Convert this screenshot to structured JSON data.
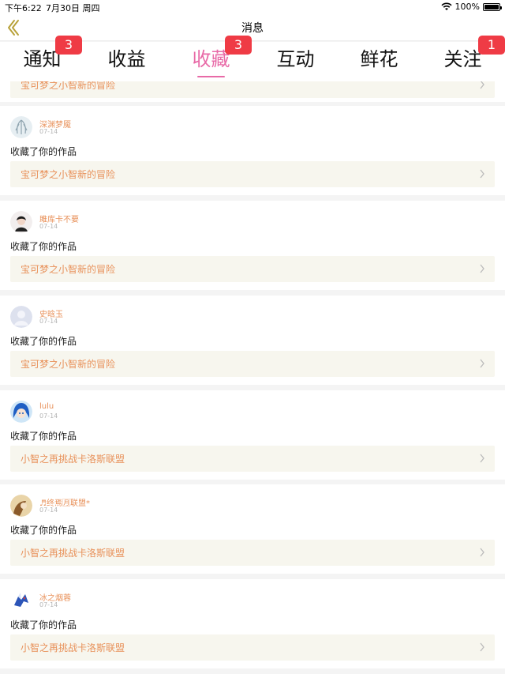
{
  "status_bar": {
    "time": "下午6:22",
    "date": "7月30日 周四",
    "battery": "100%"
  },
  "nav": {
    "title": "消息",
    "back_icon": "chevron-left-icon",
    "accent_color": "#b8a23a"
  },
  "tabs": [
    {
      "label": "通知",
      "badge": "3",
      "active": false
    },
    {
      "label": "收益",
      "badge": "",
      "active": false
    },
    {
      "label": "收藏",
      "badge": "3",
      "active": true
    },
    {
      "label": "互动",
      "badge": "",
      "active": false
    },
    {
      "label": "鲜花",
      "badge": "",
      "active": false
    },
    {
      "label": "关注",
      "badge": "1",
      "active": false
    }
  ],
  "colors": {
    "active_tab": "#e86aa7",
    "badge": "#ef3b45",
    "username": "#e8915a",
    "work_bg": "#f7f6ee"
  },
  "partial_item": {
    "work_title": "宝可梦之小智新的冒险"
  },
  "items": [
    {
      "username": "深渊梦魇",
      "date": "07-14",
      "action": "收藏了你的作品",
      "work_title": "宝可梦之小智新的冒险",
      "avatar": "ghost-avatar"
    },
    {
      "username": "雎库卡不要",
      "date": "07-14",
      "action": "收藏了你的作品",
      "work_title": "宝可梦之小智新的冒险",
      "avatar": "dark-hair-avatar"
    },
    {
      "username": "史晗玉",
      "date": "07-14",
      "action": "收藏了你的作品",
      "work_title": "宝可梦之小智新的冒险",
      "avatar": "default-avatar"
    },
    {
      "username": "lulu",
      "date": "07-14",
      "action": "收藏了你的作品",
      "work_title": "小智之再挑战卡洛斯联盟",
      "avatar": "blue-hair-avatar"
    },
    {
      "username": "♬终焉🈷联盟*",
      "date": "07-14",
      "action": "收藏了你的作品",
      "work_title": "小智之再挑战卡洛斯联盟",
      "avatar": "brown-avatar"
    },
    {
      "username": "冰之烟蓉",
      "date": "07-14",
      "action": "收藏了你的作品",
      "work_title": "小智之再挑战卡洛斯联盟",
      "avatar": "dragon-avatar"
    }
  ]
}
